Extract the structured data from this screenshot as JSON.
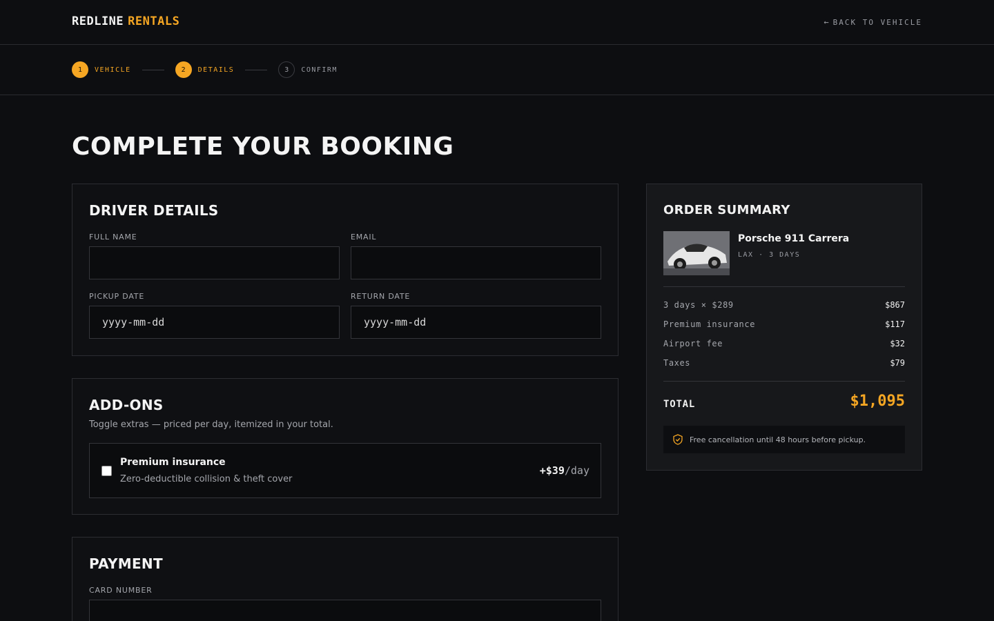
{
  "header": {
    "brand_part1": "REDLINE",
    "brand_part2": "RENTALS",
    "back_label": "BACK TO VEHICLE"
  },
  "stepper": {
    "steps": [
      {
        "number": "1",
        "label": "VEHICLE",
        "state": "completed"
      },
      {
        "number": "2",
        "label": "DETAILS",
        "state": "current"
      },
      {
        "number": "3",
        "label": "CONFIRM",
        "state": "upcoming"
      }
    ]
  },
  "page": {
    "title": "COMPLETE YOUR BOOKING"
  },
  "driver_details": {
    "title": "DRIVER DETAILS",
    "full_name_label": "FULL NAME",
    "full_name_value": "",
    "email_label": "EMAIL",
    "email_value": "",
    "pickup_label": "PICKUP DATE",
    "pickup_placeholder": "yyyy-mm-dd",
    "return_label": "RETURN DATE",
    "return_placeholder": "yyyy-mm-dd"
  },
  "addons": {
    "title": "ADD-ONS",
    "subtitle": "Toggle extras — priced per day, itemized in your total.",
    "items": [
      {
        "name": "Premium insurance",
        "description": "Zero-deductible collision & theft cover",
        "price": "+$39",
        "unit": "/day",
        "checked": false
      }
    ]
  },
  "payment": {
    "title": "PAYMENT",
    "card_number_label": "CARD NUMBER",
    "card_number_value": ""
  },
  "summary": {
    "title": "ORDER SUMMARY",
    "vehicle_name": "Porsche 911 Carrera",
    "vehicle_meta": "LAX · 3 DAYS",
    "line_items": [
      {
        "label": "3 days × $289",
        "value": "$867"
      },
      {
        "label": "Premium insurance",
        "value": "$117"
      },
      {
        "label": "Airport fee",
        "value": "$32"
      },
      {
        "label": "Taxes",
        "value": "$79"
      }
    ],
    "total_label": "TOTAL",
    "total_value": "$1,095",
    "note": "Free cancellation until 48 hours before pickup."
  },
  "colors": {
    "accent": "#f5a623",
    "background": "#0d0e11",
    "panel": "#17181b"
  },
  "icons": {
    "back": "arrow-left-icon",
    "note": "shield-check-icon"
  }
}
